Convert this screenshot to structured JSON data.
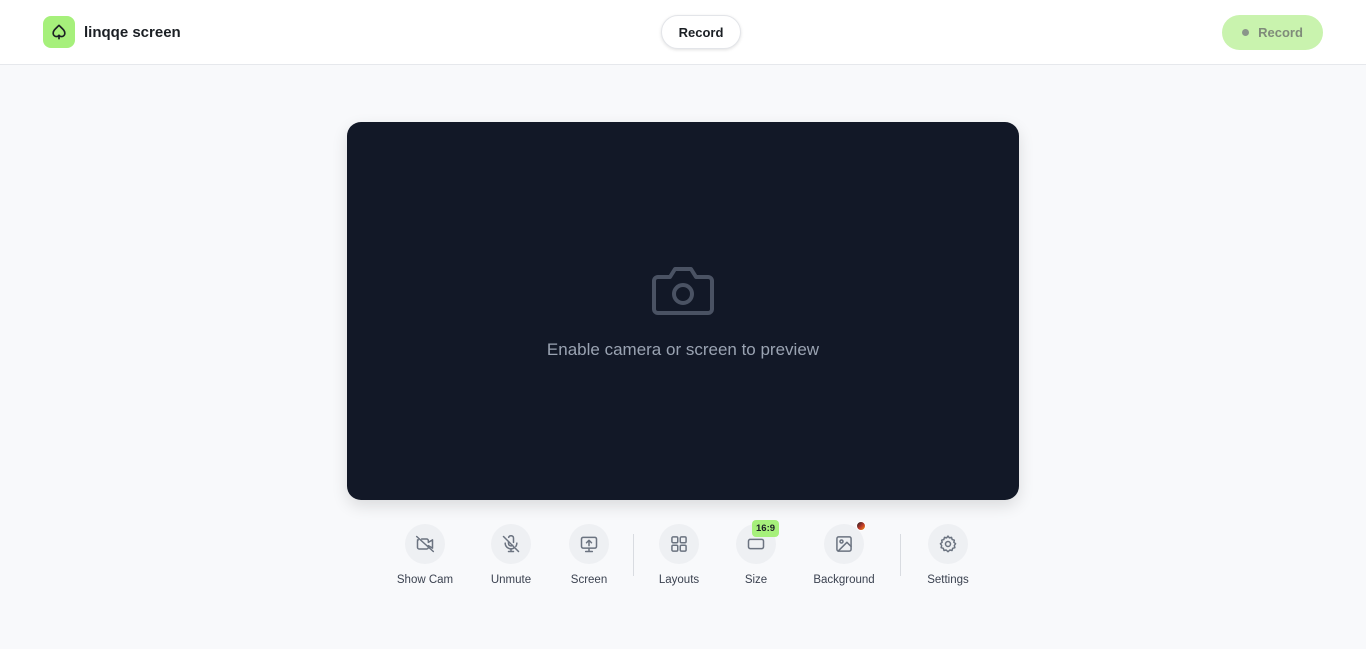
{
  "app": {
    "name": "linqqe screen"
  },
  "header": {
    "center_tab_label": "Record",
    "record_button_label": "Record"
  },
  "preview": {
    "placeholder_text": "Enable camera or screen to preview",
    "icon": "camera-icon"
  },
  "toolbar": {
    "items": [
      {
        "label": "Show Cam",
        "icon": "camera-off-icon"
      },
      {
        "label": "Unmute",
        "icon": "mic-off-icon"
      },
      {
        "label": "Screen",
        "icon": "screen-share-icon"
      },
      {
        "label": "Layouts",
        "icon": "layout-grid-icon"
      },
      {
        "label": "Size",
        "icon": "aspect-ratio-icon",
        "badge": "16:9"
      },
      {
        "label": "Background",
        "icon": "image-icon"
      },
      {
        "label": "Settings",
        "icon": "gear-icon"
      }
    ]
  },
  "colors": {
    "accent": "#a6f07b",
    "preview_bg": "#121827",
    "page_bg": "#f8f9fb"
  }
}
